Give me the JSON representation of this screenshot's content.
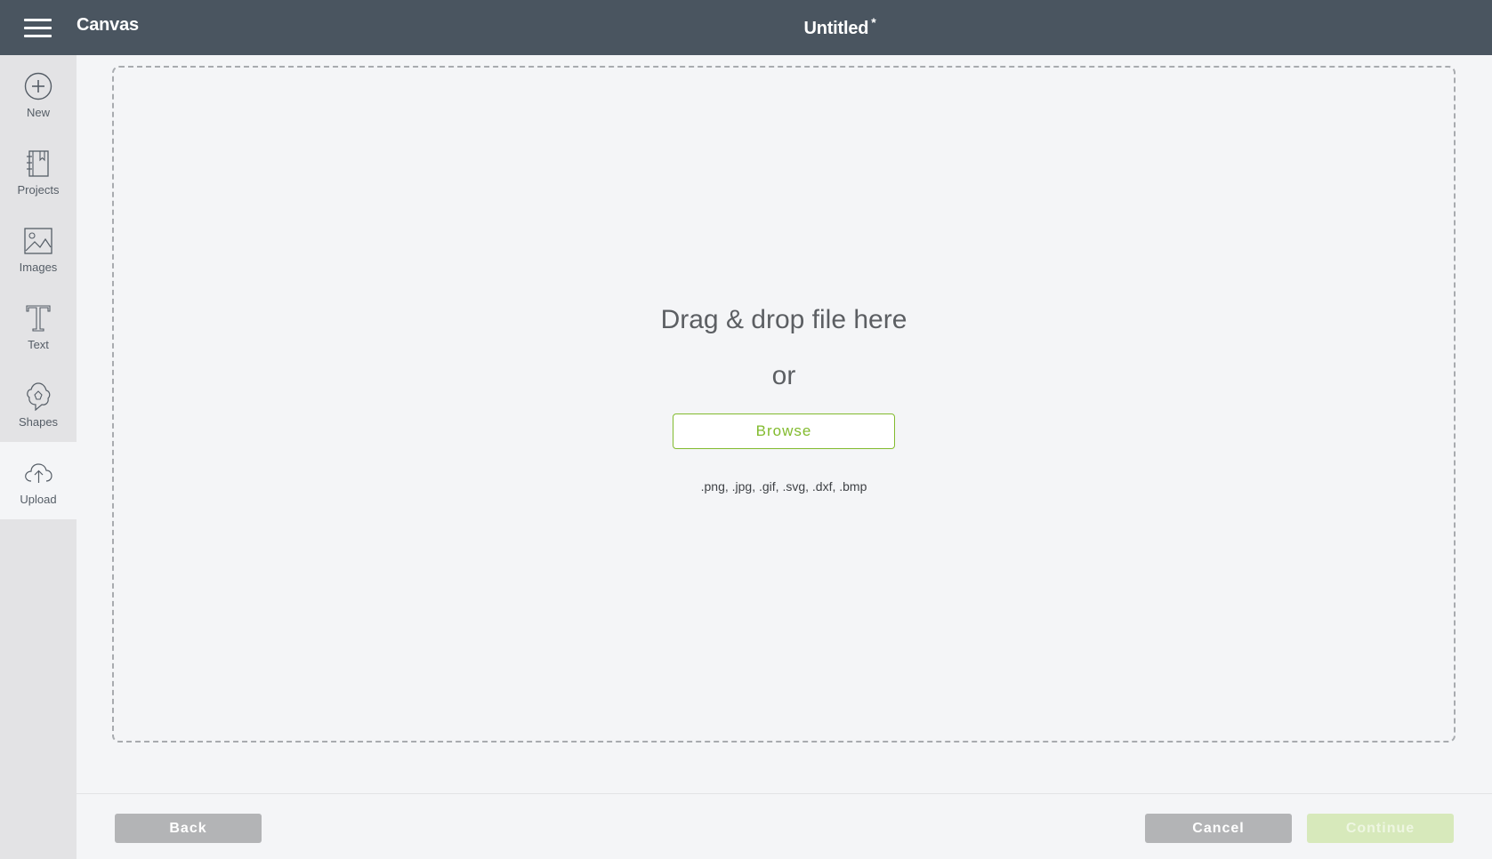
{
  "header": {
    "app_title": "Canvas",
    "doc_title": "Untitled",
    "unsaved_marker": "*",
    "menu_icon": "hamburger-menu-icon",
    "background_color": "#4a5560"
  },
  "sidebar": {
    "items": [
      {
        "label": "New",
        "icon": "plus-circle-icon",
        "active": false
      },
      {
        "label": "Projects",
        "icon": "notebook-icon",
        "active": false
      },
      {
        "label": "Images",
        "icon": "image-icon",
        "active": false
      },
      {
        "label": "Text",
        "icon": "text-t-icon",
        "active": false
      },
      {
        "label": "Shapes",
        "icon": "shapes-icon",
        "active": false
      },
      {
        "label": "Upload",
        "icon": "cloud-upload-icon",
        "active": true
      }
    ]
  },
  "dropzone": {
    "title": "Drag & drop file here",
    "or_text": "or",
    "browse_label": "Browse",
    "formats": ".png, .jpg, .gif, .svg, .dxf, .bmp",
    "accent_color": "#82bb2e"
  },
  "footer": {
    "back_label": "Back",
    "cancel_label": "Cancel",
    "continue_label": "Continue",
    "continue_disabled": true
  }
}
